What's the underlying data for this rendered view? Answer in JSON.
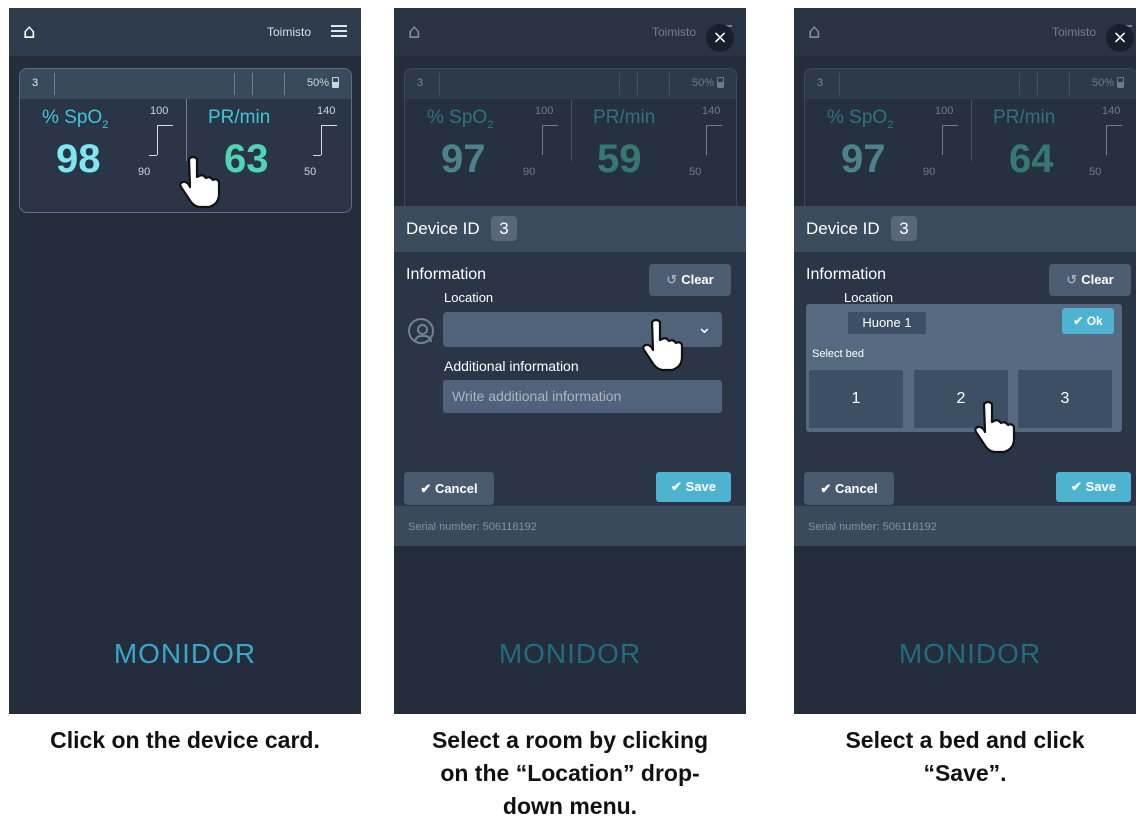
{
  "brand": "MONIDOR",
  "ward": "Toimisto",
  "screens": [
    {
      "card": {
        "id": "3",
        "battery": "50%",
        "spo2_label": "% SpO",
        "spo2_sub": "2",
        "spo2": "98",
        "spo2_high": "100",
        "spo2_low": "90",
        "pr_label": "PR/min",
        "pr": "63",
        "pr_high": "140",
        "pr_low": "50"
      },
      "caption": "Click on the device card."
    },
    {
      "card": {
        "id": "3",
        "battery": "50%",
        "spo2_label": "% SpO",
        "spo2_sub": "2",
        "spo2": "97",
        "spo2_high": "100",
        "spo2_low": "90",
        "pr_label": "PR/min",
        "pr": "59",
        "pr_high": "140",
        "pr_low": "50"
      },
      "device_id_label": "Device ID",
      "device_id": "3",
      "information_label": "Information",
      "clear_label": "Clear",
      "location_label": "Location",
      "location_value": "",
      "additional_label": "Additional information",
      "additional_placeholder": "Write additional information",
      "cancel_label": "Cancel",
      "save_label": "Save",
      "serial": "Serial number: 506118192",
      "caption_lines": [
        "Select a room by clicking",
        "on the “Location” drop-",
        "down menu."
      ]
    },
    {
      "card": {
        "id": "3",
        "battery": "50%",
        "spo2_label": "% SpO",
        "spo2_sub": "2",
        "spo2": "97",
        "spo2_high": "100",
        "spo2_low": "90",
        "pr_label": "PR/min",
        "pr": "64",
        "pr_high": "140",
        "pr_low": "50"
      },
      "device_id_label": "Device ID",
      "device_id": "3",
      "information_label": "Information",
      "clear_label": "Clear",
      "location_label": "Location",
      "room_value": "Huone 1",
      "ok_label": "Ok",
      "select_bed_label": "Select bed",
      "beds": [
        "1",
        "2",
        "3"
      ],
      "cancel_label": "Cancel",
      "save_label": "Save",
      "serial": "Serial number: 506118192",
      "caption_lines": [
        "Select a bed and click",
        "“Save”."
      ]
    }
  ]
}
